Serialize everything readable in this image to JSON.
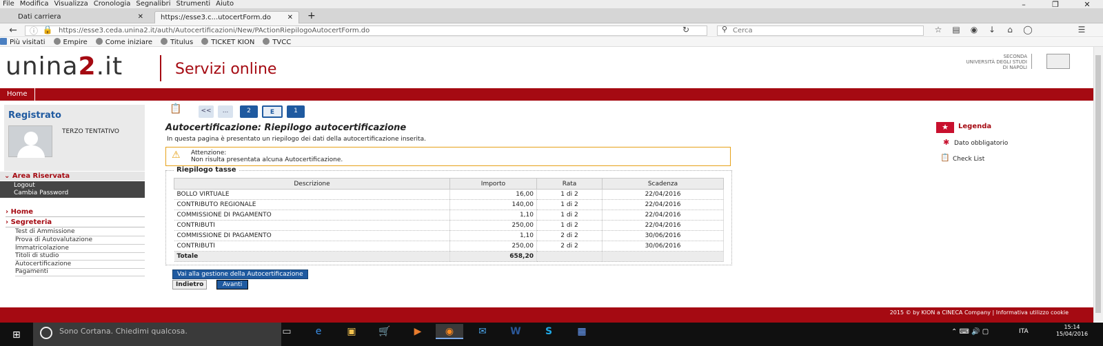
{
  "menubar": {
    "items": [
      "File",
      "Modifica",
      "Visualizza",
      "Cronologia",
      "Segnalibri",
      "Strumenti",
      "Aiuto"
    ]
  },
  "tabs": [
    {
      "label": "Dati carriera"
    },
    {
      "label": "https://esse3.c...utocertForm.do"
    }
  ],
  "urlbar": {
    "url": "https://esse3.ceda.unina2.it/auth/Autocertificazioni/New/PActionRiepilogoAutocertForm.do",
    "search_placeholder": "Cerca"
  },
  "bookmarks": [
    "Più visitati",
    "Empire",
    "Come iniziare",
    "Titulus",
    "TICKET KION",
    "TVCC"
  ],
  "header": {
    "logo_pre": "unina",
    "logo_mid": "2",
    "logo_post": ".it",
    "services": "Servizi online",
    "uni_line1": "SECONDA",
    "uni_line2": "UNIVERSITÀ DEGLI STUDI",
    "uni_line3": "DI NAPOLI"
  },
  "nav": {
    "home": "Home"
  },
  "sidebar": {
    "title": "Registrato",
    "user": "TERZO TENTATIVO",
    "area": "Area Riservata",
    "logout": "Logout",
    "cambia": "Cambia Password",
    "home": "Home",
    "segreteria": "Segreteria",
    "items": [
      "Test di Ammissione",
      "Prova di Autovalutazione",
      "Immatricolazione",
      "Titoli di studio",
      "Autocertificazione",
      "Pagamenti"
    ]
  },
  "pager": {
    "first": "<<",
    "dots": "...",
    "p2": "2",
    "pe": "E",
    "p1": "1"
  },
  "main": {
    "title": "Autocertificazione: Riepilogo autocertificazione",
    "desc": "In questa pagina è presentato un riepilogo dei dati della autocertificazione inserita.",
    "warn_title": "Attenzione:",
    "warn_text": "Non risulta presentata alcuna Autocertificazione.",
    "legend": "Riepilogo tasse",
    "columns": [
      "Descrizione",
      "Importo",
      "Rata",
      "Scadenza"
    ],
    "rows": [
      [
        "BOLLO VIRTUALE",
        "16,00",
        "1 di 2",
        "22/04/2016"
      ],
      [
        "CONTRIBUTO REGIONALE",
        "140,00",
        "1 di 2",
        "22/04/2016"
      ],
      [
        "COMMISSIONE DI PAGAMENTO",
        "1,10",
        "1 di 2",
        "22/04/2016"
      ],
      [
        "CONTRIBUTI",
        "250,00",
        "1 di 2",
        "22/04/2016"
      ],
      [
        "COMMISSIONE DI PAGAMENTO",
        "1,10",
        "2 di 2",
        "30/06/2016"
      ],
      [
        "CONTRIBUTI",
        "250,00",
        "2 di 2",
        "30/06/2016"
      ]
    ],
    "total_label": "Totale",
    "total_value": "658,20",
    "btn_gestione": "Vai alla gestione della Autocertificazione",
    "btn_indietro": "Indietro",
    "btn_avanti": "Avanti"
  },
  "legenda": {
    "title": "Legenda",
    "obbligatorio": "Dato obbligatorio",
    "checklist": "Check List"
  },
  "footer": {
    "text": "2015 © by KION a CINECA Company  |  Informativa utilizzo cookie"
  },
  "taskbar": {
    "cortana": "Sono Cortana. Chiedimi qualcosa.",
    "lang": "ITA",
    "time": "15:14",
    "date": "15/04/2016"
  }
}
